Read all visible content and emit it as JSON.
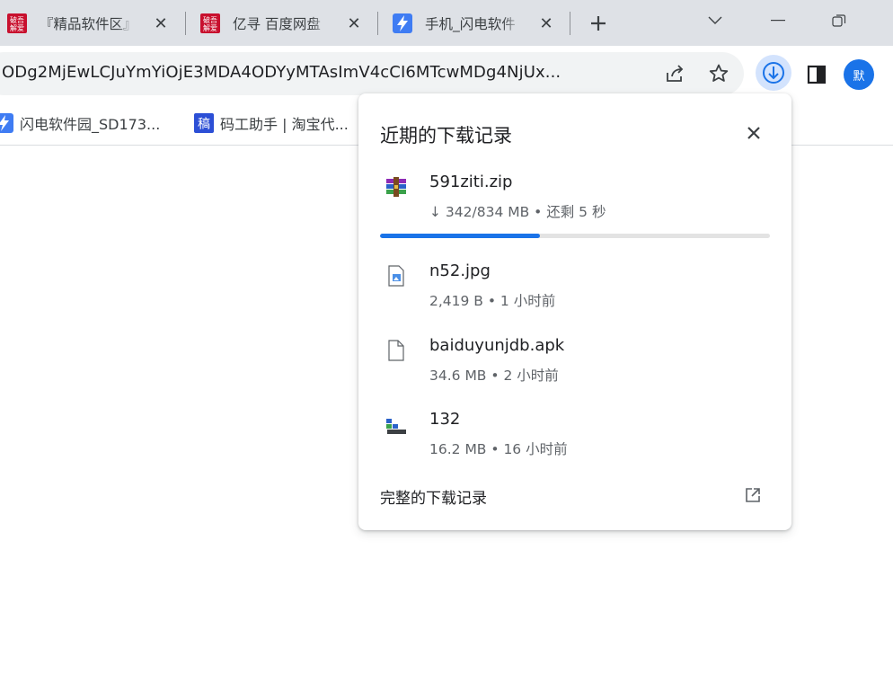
{
  "tabs": [
    {
      "title": "『精品软件区』",
      "favicon": "pojie-logo-icon"
    },
    {
      "title": "亿寻 百度网盘",
      "favicon": "pojie-logo-icon"
    },
    {
      "title": "手机_闪电软件",
      "favicon": "lightning-icon"
    }
  ],
  "address_bar": {
    "url": "ODg2MjEwLCJuYmYiOjE3MDA4ODYyMTAsImV4cCI6MTcwMDg4NjUx..."
  },
  "profile": {
    "initial": "默"
  },
  "bookmarks": [
    {
      "label": "闪电软件园_SD173...",
      "favicon": "lightning-icon"
    },
    {
      "label": "码工助手 | 淘宝代...",
      "favicon": "gao-logo-icon"
    }
  ],
  "downloads_panel": {
    "title": "近期的下载记录",
    "items": [
      {
        "name": "591ziti.zip",
        "meta": "↓ 342/834 MB • 还剩 5 秒",
        "icon": "winrar-archive-icon",
        "progress": 0.41
      },
      {
        "name": "n52.jpg",
        "meta": "2,419 B • 1 小时前",
        "icon": "image-file-icon"
      },
      {
        "name": "baiduyunjdb.apk",
        "meta": "34.6 MB • 2 小时前",
        "icon": "generic-file-icon"
      },
      {
        "name": "132",
        "meta": "16.2 MB • 16 小时前",
        "icon": "installer-file-icon"
      }
    ],
    "full_history_label": "完整的下载记录"
  },
  "colors": {
    "accent": "#1a73e8",
    "tabstrip": "#dee1e6",
    "download_button_bg": "#d3e3fd"
  }
}
